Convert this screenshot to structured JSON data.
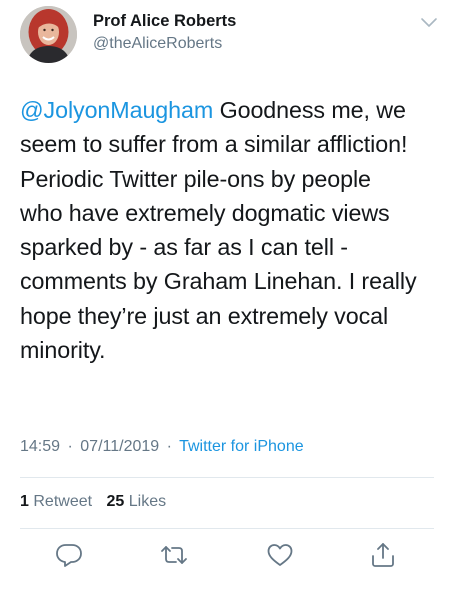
{
  "author": {
    "display_name": "Prof Alice Roberts",
    "handle": "@theAliceRoberts",
    "avatar_icon": "profile-photo"
  },
  "tweet": {
    "mention": "@JolyonMaugham",
    "lines": [
      " Goodness me, we",
      "seem to suffer from a similar affliction!",
      "Periodic Twitter pile-ons by people",
      "who have extremely dogmatic views",
      "sparked by - as far as I can tell -",
      "comments by Graham Linehan. I really",
      "hope they’re just an extremely vocal",
      "minority."
    ],
    "time": "14:59",
    "date": "07/11/2019",
    "separator": "·",
    "source": "Twitter for iPhone"
  },
  "stats": {
    "retweets_count": "1",
    "retweets_label": "Retweet",
    "likes_count": "25",
    "likes_label": "Likes"
  },
  "actions": [
    "reply-icon",
    "retweet-icon",
    "like-icon",
    "share-icon"
  ],
  "colors": {
    "link": "#1b95e0",
    "secondary": "#657786",
    "text": "#14171a",
    "divider": "#e1e8ed"
  }
}
